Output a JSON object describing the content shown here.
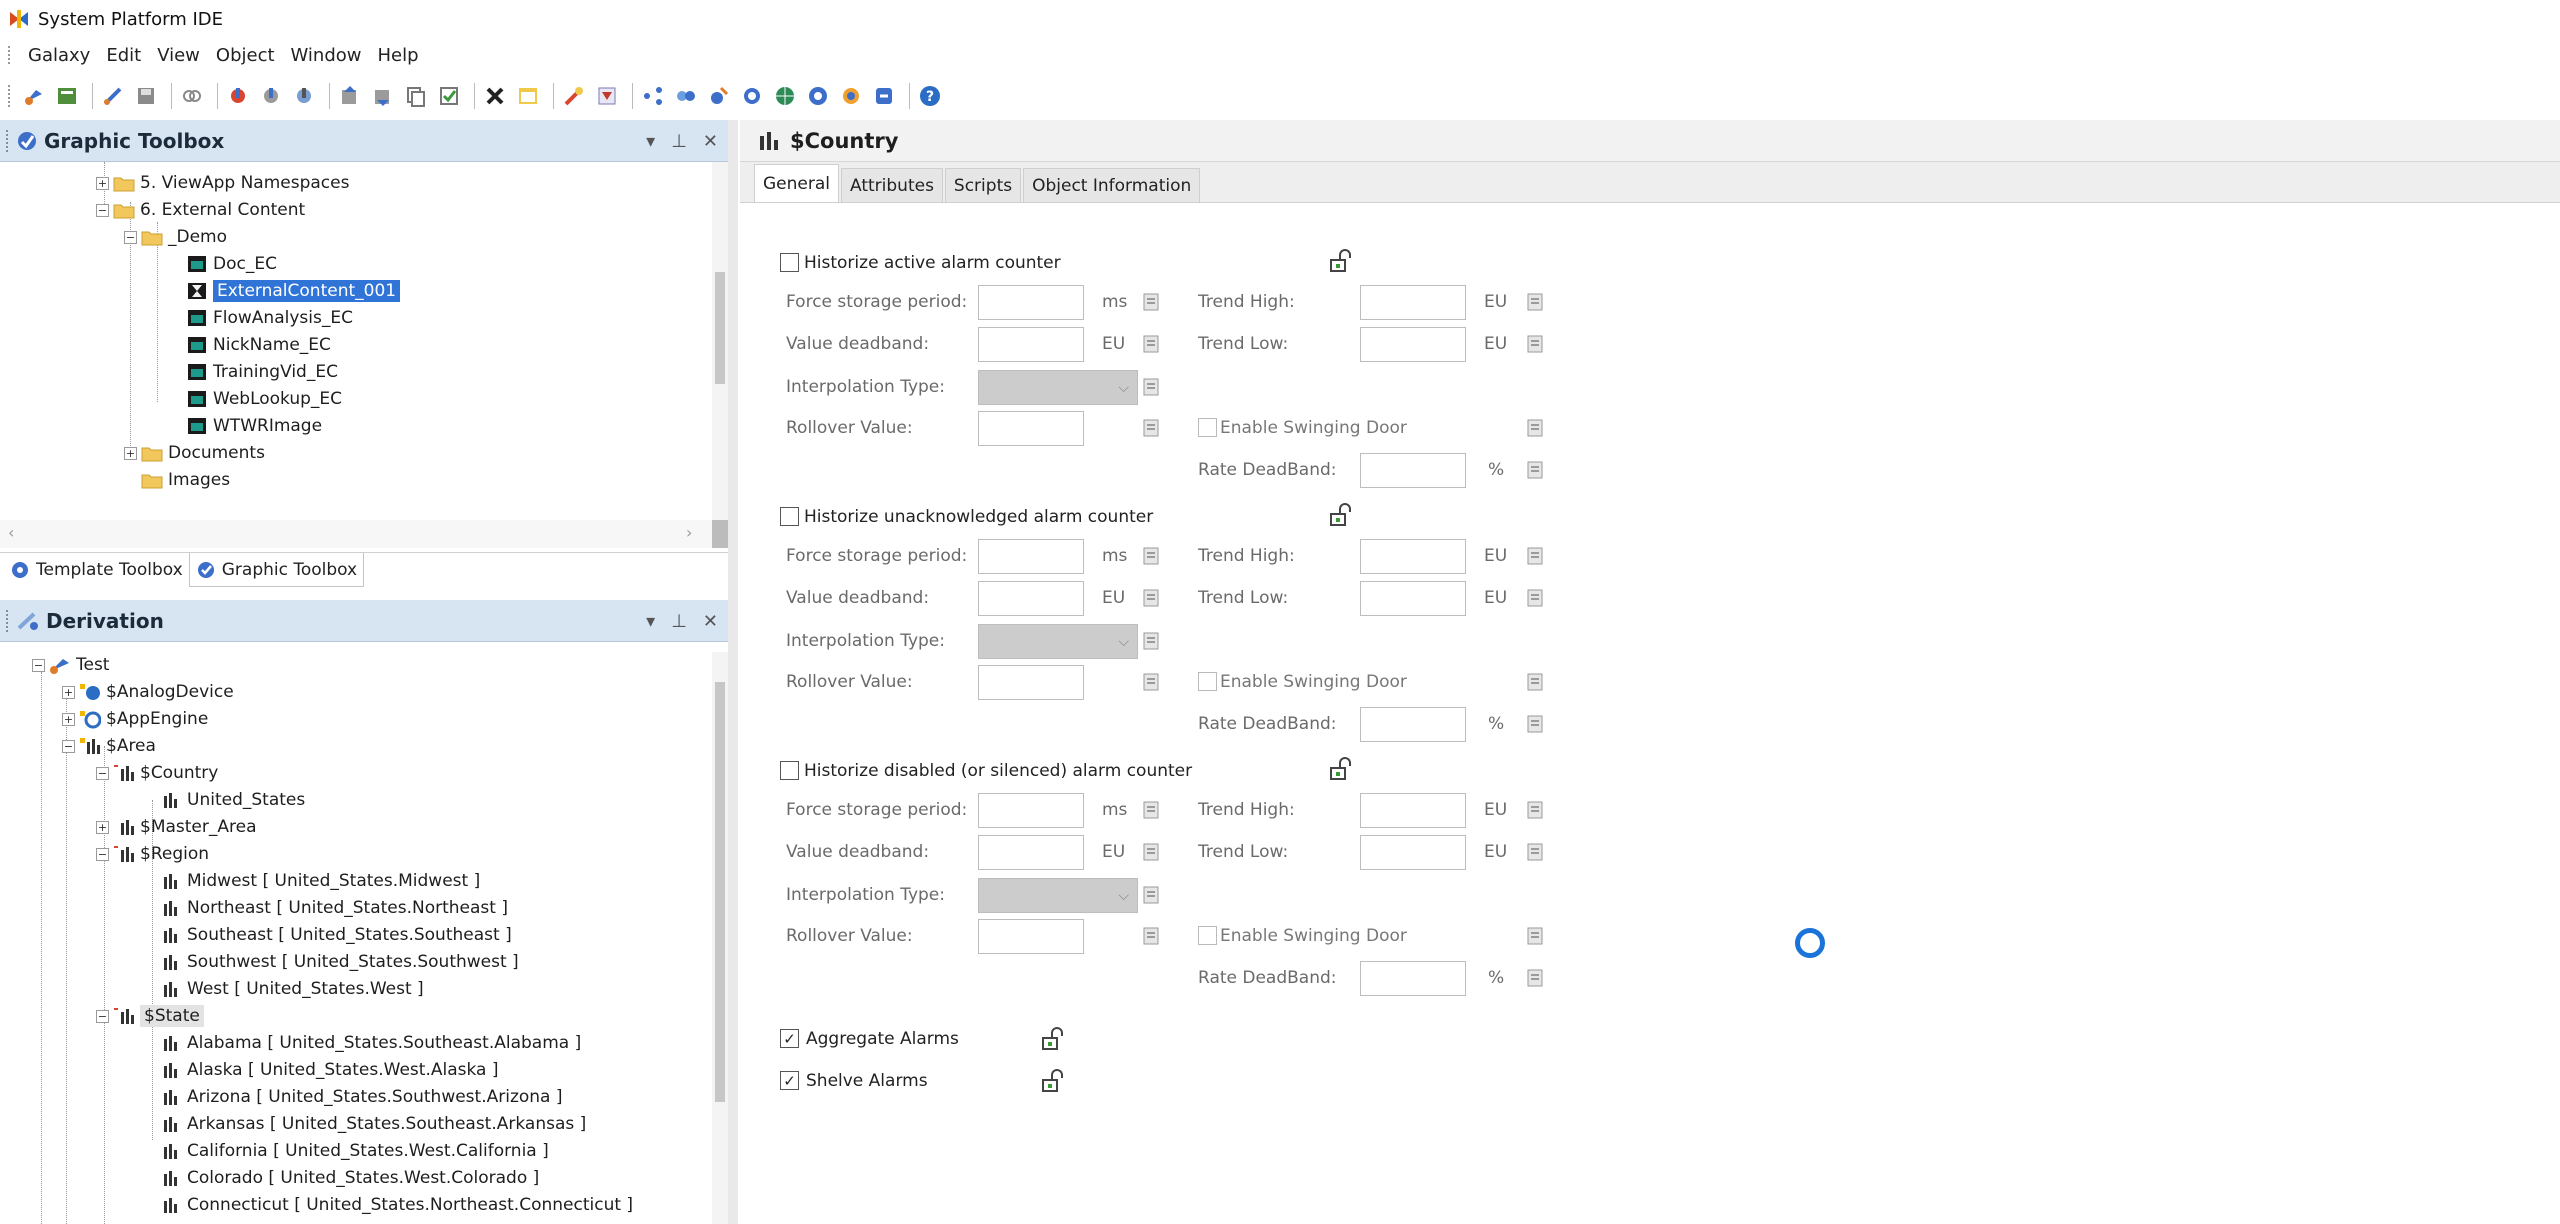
{
  "app": {
    "title": "System Platform IDE"
  },
  "menu": [
    "Galaxy",
    "Edit",
    "View",
    "Object",
    "Window",
    "Help"
  ],
  "graphic_toolbox": {
    "title": "Graphic Toolbox",
    "tree": [
      {
        "label": "5. ViewApp Namespaces"
      },
      {
        "label": "6. External Content"
      },
      {
        "label": "_Demo"
      },
      {
        "label": "Doc_EC"
      },
      {
        "label": "ExternalContent_001"
      },
      {
        "label": "FlowAnalysis_EC"
      },
      {
        "label": "NickName_EC"
      },
      {
        "label": "TrainingVid_EC"
      },
      {
        "label": "WebLookup_EC"
      },
      {
        "label": "WTWRImage"
      },
      {
        "label": "Documents"
      },
      {
        "label": "Images"
      }
    ]
  },
  "toolbox_tabs": [
    "Template Toolbox",
    "Graphic Toolbox"
  ],
  "derivation": {
    "title": "Derivation",
    "tree": [
      {
        "label": "Test"
      },
      {
        "label": "$AnalogDevice"
      },
      {
        "label": "$AppEngine"
      },
      {
        "label": "$Area"
      },
      {
        "label": "$Country"
      },
      {
        "label": "United_States"
      },
      {
        "label": "$Master_Area"
      },
      {
        "label": "$Region"
      },
      {
        "label": "Midwest [ United_States.Midwest ]"
      },
      {
        "label": "Northeast [ United_States.Northeast ]"
      },
      {
        "label": "Southeast [ United_States.Southeast ]"
      },
      {
        "label": "Southwest [ United_States.Southwest ]"
      },
      {
        "label": "West [ United_States.West ]"
      },
      {
        "label": "$State"
      },
      {
        "label": "Alabama [ United_States.Southeast.Alabama ]"
      },
      {
        "label": "Alaska [ United_States.West.Alaska ]"
      },
      {
        "label": "Arizona [ United_States.Southwest.Arizona ]"
      },
      {
        "label": "Arkansas [ United_States.Southeast.Arkansas ]"
      },
      {
        "label": "California [ United_States.West.California ]"
      },
      {
        "label": "Colorado [ United_States.West.Colorado ]"
      },
      {
        "label": "Connecticut [ United_States.Northeast.Connecticut ]"
      }
    ]
  },
  "editor": {
    "title": "$Country",
    "tabs": [
      "General",
      "Attributes",
      "Scripts",
      "Object Information"
    ],
    "sections": [
      {
        "checkbox_label": "Historize active alarm counter",
        "checked": false
      },
      {
        "checkbox_label": "Historize unacknowledged alarm counter",
        "checked": false
      },
      {
        "checkbox_label": "Historize disabled (or silenced) alarm counter",
        "checked": false
      }
    ],
    "labels": {
      "force_storage": "Force storage period:",
      "value_deadband": "Value deadband:",
      "interpolation": "Interpolation Type:",
      "rollover": "Rollover Value:",
      "trend_high": "Trend High:",
      "trend_low": "Trend Low:",
      "swinging_door": "Enable Swinging Door",
      "rate_deadband": "Rate DeadBand:",
      "unit_ms": "ms",
      "unit_eu": "EU",
      "unit_pct": "%"
    },
    "aggregate": {
      "label": "Aggregate Alarms",
      "checked": true
    },
    "shelve": {
      "label": "Shelve Alarms",
      "checked": true
    }
  },
  "colors": {
    "selection": "#2f74d6",
    "panel_header": "#d7e4f2",
    "busy_ring": "#1a73d9"
  }
}
